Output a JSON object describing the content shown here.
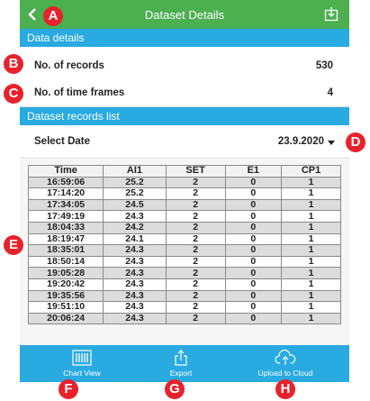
{
  "header": {
    "title": "Dataset Details"
  },
  "data_details": {
    "section_title": "Data details",
    "records_label": "No. of records",
    "records_value": "530",
    "frames_label": "No. of time frames",
    "frames_value": "4"
  },
  "records_list": {
    "section_title": "Dataset records list",
    "select_date_label": "Select Date",
    "selected_date": "23.9.2020"
  },
  "table": {
    "headers": [
      "Time",
      "AI1",
      "SET",
      "E1",
      "CP1"
    ],
    "rows": [
      [
        "16:59:06",
        "25.2",
        "2",
        "0",
        "1"
      ],
      [
        "17:14:20",
        "25.2",
        "2",
        "0",
        "1"
      ],
      [
        "17:34:05",
        "24.5",
        "2",
        "0",
        "1"
      ],
      [
        "17:49:19",
        "24.3",
        "2",
        "0",
        "1"
      ],
      [
        "18:04:33",
        "24.2",
        "2",
        "0",
        "1"
      ],
      [
        "18:19:47",
        "24.1",
        "2",
        "0",
        "1"
      ],
      [
        "18:35:01",
        "24.3",
        "2",
        "0",
        "1"
      ],
      [
        "18:50:14",
        "24.3",
        "2",
        "0",
        "1"
      ],
      [
        "19:05:28",
        "24.3",
        "2",
        "0",
        "1"
      ],
      [
        "19:20:42",
        "24.3",
        "2",
        "0",
        "1"
      ],
      [
        "19:35:56",
        "24.3",
        "2",
        "0",
        "1"
      ],
      [
        "19:51:10",
        "24.3",
        "2",
        "0",
        "1"
      ],
      [
        "20:06:24",
        "24.3",
        "2",
        "0",
        "1"
      ]
    ]
  },
  "toolbar": {
    "chart_view_label": "Chart View",
    "export_label": "Export",
    "upload_label": "Upload to Cloud"
  },
  "markers": {
    "a": "A",
    "b": "B",
    "c": "C",
    "d": "D",
    "e": "E",
    "f": "F",
    "g": "G",
    "h": "H"
  },
  "colors": {
    "title_bar": "#4caf50",
    "section_header": "#29aae1",
    "toolbar": "#29aae1",
    "marker": "#e8212b"
  }
}
